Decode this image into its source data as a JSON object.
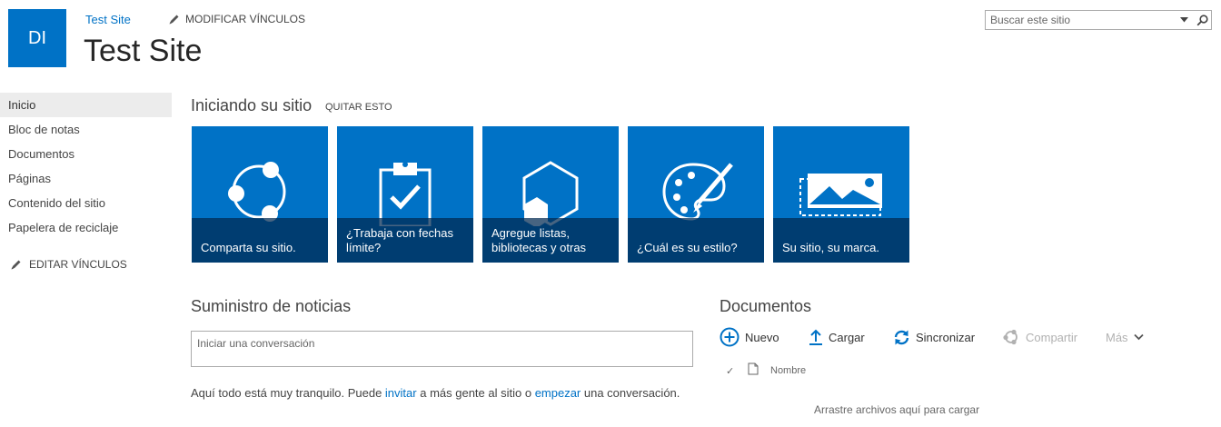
{
  "header": {
    "logo_text": "DI",
    "site_link": "Test Site",
    "edit_links": "MODIFICAR VÍNCULOS",
    "site_title": "Test Site",
    "search_placeholder": "Buscar este sitio"
  },
  "leftnav": {
    "items": [
      {
        "label": "Inicio",
        "selected": true
      },
      {
        "label": "Bloc de notas"
      },
      {
        "label": "Documentos"
      },
      {
        "label": "Páginas"
      },
      {
        "label": "Contenido del sitio"
      },
      {
        "label": "Papelera de reciclaje"
      }
    ],
    "edit_links": "EDITAR VÍNCULOS"
  },
  "getting_started": {
    "title": "Iniciando su sitio",
    "remove": "QUITAR ESTO",
    "tiles": [
      {
        "label": "Comparta su sitio.",
        "icon": "share-icon"
      },
      {
        "label": "¿Trabaja con fechas límite?",
        "icon": "clipboard-check-icon"
      },
      {
        "label": "Agregue listas, bibliotecas y otras",
        "icon": "add-apps-icon"
      },
      {
        "label": "¿Cuál es su estilo?",
        "icon": "palette-icon"
      },
      {
        "label": "Su sitio, su marca.",
        "icon": "picture-icon"
      }
    ]
  },
  "newsfeed": {
    "title": "Suministro de noticias",
    "placeholder": "Iniciar una conversación",
    "quiet_prefix": "Aquí todo está muy tranquilo. Puede ",
    "invite_link": "invitar",
    "quiet_middle": " a más gente al sitio o ",
    "start_link": "empezar",
    "quiet_suffix": " una conversación."
  },
  "documents": {
    "title": "Documentos",
    "commands": {
      "new": "Nuevo",
      "upload": "Cargar",
      "sync": "Sincronizar",
      "share": "Compartir",
      "more": "Más"
    },
    "column_name": "Nombre",
    "drop_hint": "Arrastre archivos aquí para cargar"
  },
  "colors": {
    "brand": "#0072c6",
    "tile_caption": "#002850",
    "disabled": "#b1b1b1"
  }
}
